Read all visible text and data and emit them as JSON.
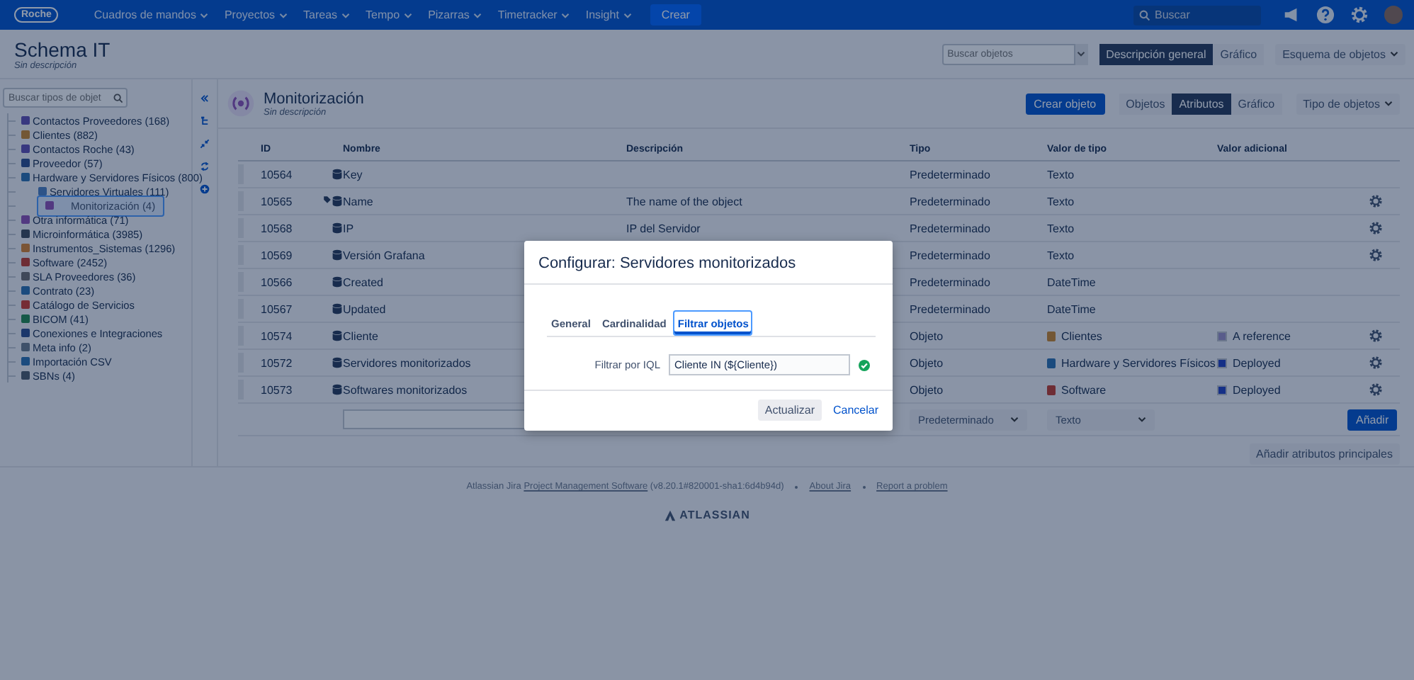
{
  "top_nav": {
    "logo": "Roche",
    "menus": [
      {
        "label": "Cuadros de mandos"
      },
      {
        "label": "Proyectos"
      },
      {
        "label": "Tareas"
      },
      {
        "label": "Tempo"
      },
      {
        "label": "Pizarras"
      },
      {
        "label": "Timetracker"
      },
      {
        "label": "Insight"
      }
    ],
    "create": "Crear",
    "search": {
      "placeholder": "Buscar"
    }
  },
  "schema": {
    "title": "Schema IT",
    "description": "Sin descripción",
    "search": {
      "placeholder": "Buscar objetos"
    },
    "views": [
      {
        "label": "Descripción general",
        "selected": true
      },
      {
        "label": "Gráfico",
        "selected": false
      }
    ],
    "dropdown": "Esquema de objetos"
  },
  "sidebar": {
    "search": {
      "placeholder": "Buscar tipos de objet"
    },
    "items": [
      {
        "label": "Contactos Proveedores (168)",
        "color": "#383880",
        "selected": false
      },
      {
        "label": "Clientes (882)",
        "color": "#735735",
        "selected": false
      },
      {
        "label": "Contactos Roche (43)",
        "color": "#383880",
        "selected": false
      },
      {
        "label": "Proveedor (57)",
        "color": "#1b376b",
        "selected": false
      },
      {
        "label": "Hardware y Servidores Físicos (800)",
        "color": "#1b4b7e",
        "selected": false,
        "children": [
          {
            "label": "Servidores Virtuales (111)",
            "color": "#2d5388",
            "selected": false
          },
          {
            "label": "Monitorización (4)",
            "color": "#523981",
            "selected": true
          }
        ]
      },
      {
        "label": "Otra informática (71)",
        "color": "#523981",
        "selected": false
      },
      {
        "label": "Microinformática (3985)",
        "color": "#25364f",
        "selected": false
      },
      {
        "label": "Instrumentos_Sistemas (1296)",
        "color": "#7b5536",
        "selected": false
      },
      {
        "label": "Software (2452)",
        "color": "#6e2d35",
        "selected": false
      },
      {
        "label": "SLA Proveedores (36)",
        "color": "#3f4859",
        "selected": false
      },
      {
        "label": "Contrato (23)",
        "color": "#1b4b7e",
        "selected": false
      },
      {
        "label": "Catálogo de Servicios",
        "color": "#762d35",
        "selected": false
      },
      {
        "label": "BICOM (41)",
        "color": "#155948",
        "selected": false
      },
      {
        "label": "Conexiones e Integraciones",
        "color": "#1b376b",
        "selected": false
      },
      {
        "label": "Meta info (2)",
        "color": "#3f516a",
        "selected": false
      },
      {
        "label": "Importación CSV",
        "color": "#1b4b7e",
        "selected": false
      },
      {
        "label": "SBNs (4)",
        "color": "#2d3f58",
        "selected": false
      }
    ]
  },
  "object_type": {
    "title": "Monitorización",
    "description": "Sin descripción",
    "create": "Crear objeto",
    "views": [
      {
        "label": "Objetos",
        "selected": false
      },
      {
        "label": "Atributos",
        "selected": true
      },
      {
        "label": "Gráfico",
        "selected": false
      }
    ],
    "dropdown": "Tipo de objetos"
  },
  "table": {
    "columns": [
      "ID",
      "Nombre",
      "Descripción",
      "Tipo",
      "Valor de tipo",
      "Valor adicional"
    ],
    "rows": [
      {
        "id": "10564",
        "label": false,
        "name": "Key",
        "description": "",
        "type": "Predeterminado",
        "type_value": {
          "text": "Texto"
        },
        "settings": false
      },
      {
        "id": "10565",
        "label": true,
        "name": "Name",
        "description": "The name of the object",
        "type": "Predeterminado",
        "type_value": {
          "text": "Texto"
        },
        "settings": true
      },
      {
        "id": "10568",
        "label": false,
        "name": "IP",
        "description": "IP del Servidor",
        "type": "Predeterminado",
        "type_value": {
          "text": "Texto"
        },
        "settings": true
      },
      {
        "id": "10569",
        "label": false,
        "name": "Versión Grafana",
        "description": "",
        "type": "Predeterminado",
        "type_value": {
          "text": "Texto"
        },
        "settings": true
      },
      {
        "id": "10566",
        "label": false,
        "name": "Created",
        "description": "",
        "type": "Predeterminado",
        "type_value": {
          "text": "DateTime"
        },
        "settings": false
      },
      {
        "id": "10567",
        "label": false,
        "name": "Updated",
        "description": "",
        "type": "Predeterminado",
        "type_value": {
          "text": "DateTime"
        },
        "settings": false
      },
      {
        "id": "10574",
        "label": false,
        "name": "Cliente",
        "description": "",
        "type": "Objeto",
        "type_value": {
          "text": "Clientes",
          "color": "#735735"
        },
        "additional": {
          "label": "A reference",
          "color": "#595c8b"
        },
        "settings": true
      },
      {
        "id": "10572",
        "label": false,
        "name": "Servidores monitorizados",
        "description": "",
        "type": "Objeto",
        "type_value": {
          "text": "Hardware y Servidores Físicos",
          "color": "#1b4b7e"
        },
        "additional": {
          "label": "Deployed",
          "color": "#153087"
        },
        "settings": true
      },
      {
        "id": "10573",
        "label": false,
        "name": "Softwares monitorizados",
        "description": "",
        "type": "Objeto",
        "type_value": {
          "text": "Software",
          "color": "#6e2d35"
        },
        "additional": {
          "label": "Deployed",
          "color": "#153087"
        },
        "settings": true
      }
    ],
    "new_row": {
      "type": "Predeterminado",
      "type_value": "Texto",
      "add": "Añadir"
    },
    "add_main": "Añadir atributos principales"
  },
  "footer": {
    "product": "Atlassian Jira",
    "link": "Project Management Software",
    "version": "(v8.20.1#820001-sha1:6d4b94d)",
    "about": "About Jira",
    "report": "Report a problem",
    "logo": "ATLASSIAN"
  },
  "dialog": {
    "title": "Configurar: Servidores monitorizados",
    "tabs": [
      {
        "label": "General",
        "selected": false
      },
      {
        "label": "Cardinalidad",
        "selected": false
      },
      {
        "label": "Filtrar objetos",
        "selected": true
      }
    ],
    "field_label": "Filtrar por IQL",
    "value": "Cliente IN (${Cliente})",
    "valid": true,
    "primary": "Actualizar",
    "cancel": "Cancelar"
  }
}
